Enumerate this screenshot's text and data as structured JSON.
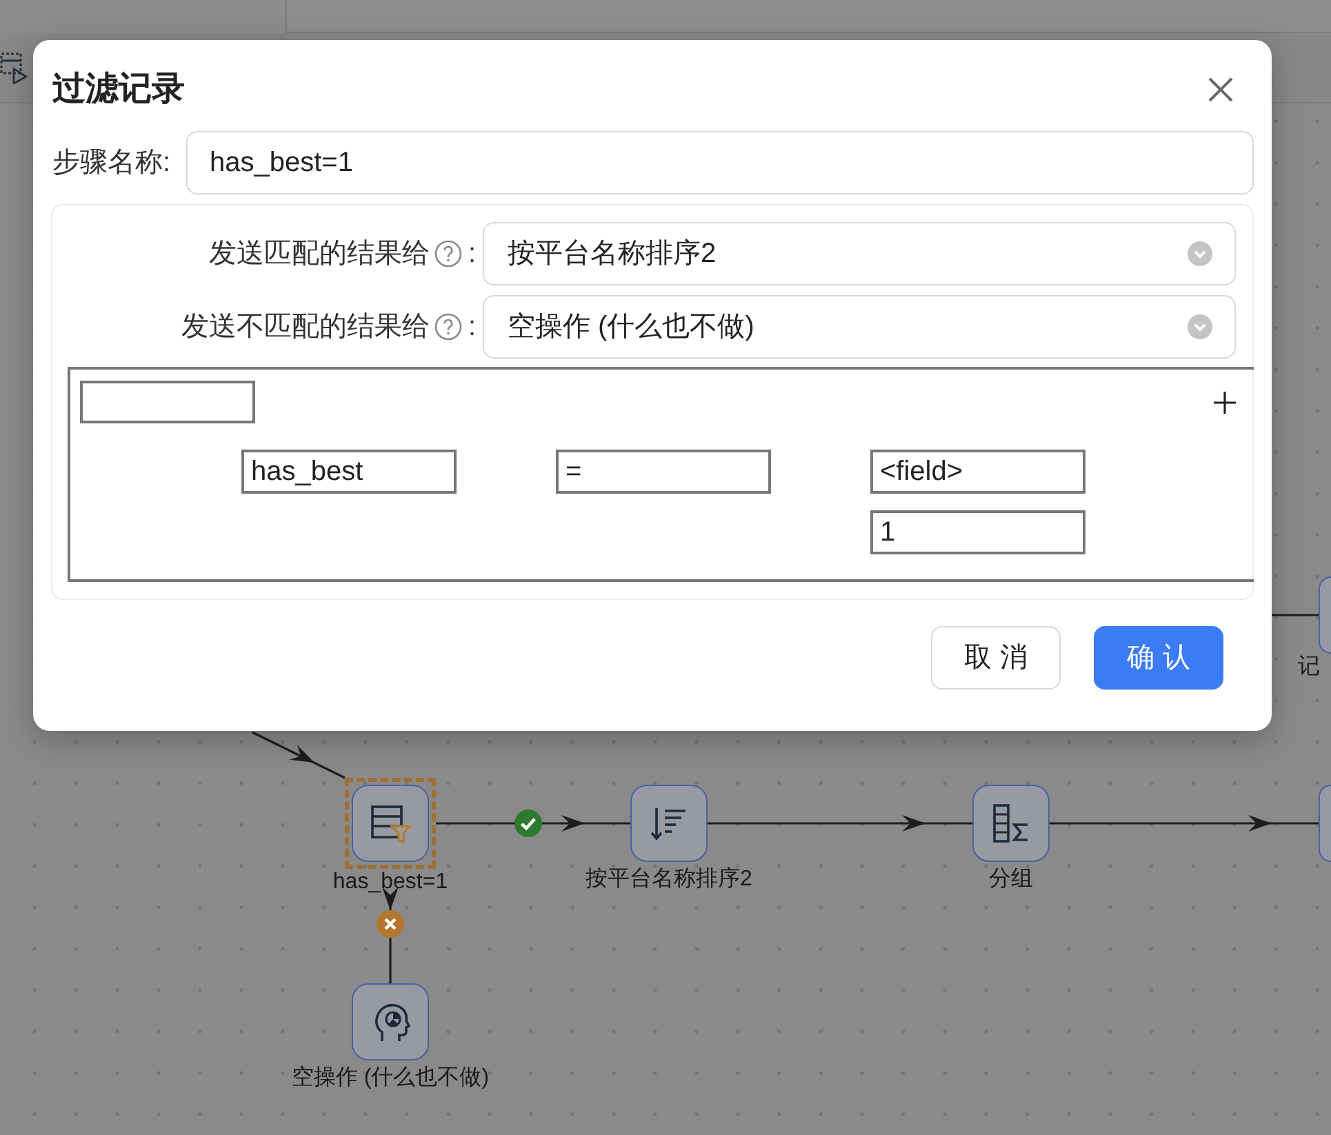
{
  "dialog": {
    "title": "过滤记录",
    "step_name": {
      "label": "步骤名称:",
      "value": "has_best=1"
    },
    "targets": [
      {
        "label": "发送匹配的结果给",
        "colon": ":",
        "value": "按平台名称排序2"
      },
      {
        "label": "发送不匹配的结果给",
        "colon": ":",
        "value": "空操作 (什么也不做)"
      }
    ],
    "condition": {
      "field": "has_best",
      "operator": "=",
      "compare_field": "<field>",
      "value": "1"
    },
    "buttons": [
      {
        "label": "取 消",
        "kind": "secondary"
      },
      {
        "label": "确 认",
        "kind": "primary"
      }
    ]
  },
  "canvas": {
    "nodes": [
      {
        "kind": "filter",
        "label": "has_best=1",
        "selected": true
      },
      {
        "kind": "sort",
        "label": "按平台名称排序2",
        "selected": false
      },
      {
        "kind": "group",
        "label": "分组",
        "selected": false
      },
      {
        "kind": "dummy",
        "label": "空操作 (什么也不做)",
        "selected": false
      },
      {
        "kind": "partial",
        "label": "记",
        "selected": false
      },
      {
        "kind": "partial",
        "selected": false
      }
    ],
    "connectors": [
      {
        "kind": "plain"
      },
      {
        "kind": "match"
      },
      {
        "kind": "plain"
      },
      {
        "kind": "no_match"
      },
      {
        "kind": "plain"
      },
      {
        "kind": "plain"
      }
    ]
  }
}
